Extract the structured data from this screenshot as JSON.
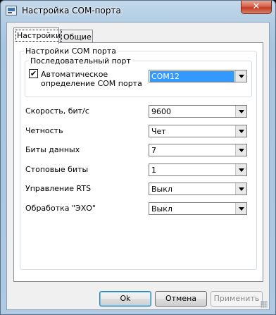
{
  "window": {
    "title": "Настройка COM-порта",
    "close_glyph": "✕"
  },
  "tabs": [
    {
      "label": "Настройки",
      "active": true
    },
    {
      "label": "Общие",
      "active": false
    }
  ],
  "settings_group": {
    "title": "Настройки COM порта"
  },
  "serial_group": {
    "title": "Последовательный порт",
    "auto_detect": {
      "label_line1": "Автоматическое",
      "label_line2": "определение COM порта",
      "checked": true,
      "check_glyph": "✔"
    },
    "port": {
      "value": "COM12"
    }
  },
  "fields": [
    {
      "label": "Скорость, бит/с",
      "value": "9600"
    },
    {
      "label": "Четность",
      "value": "Чет"
    },
    {
      "label": "Биты данных",
      "value": "7"
    },
    {
      "label": "Стоповые биты",
      "value": "1"
    },
    {
      "label": "Управление RTS",
      "value": "Выкл"
    },
    {
      "label": "Обработка \"ЭХО\"",
      "value": "Выкл"
    }
  ],
  "buttons": {
    "ok": "Ok",
    "cancel": "Отмена",
    "apply": "Применить"
  },
  "colors": {
    "selection": "#3399ff",
    "close_button": "#c23a21"
  }
}
